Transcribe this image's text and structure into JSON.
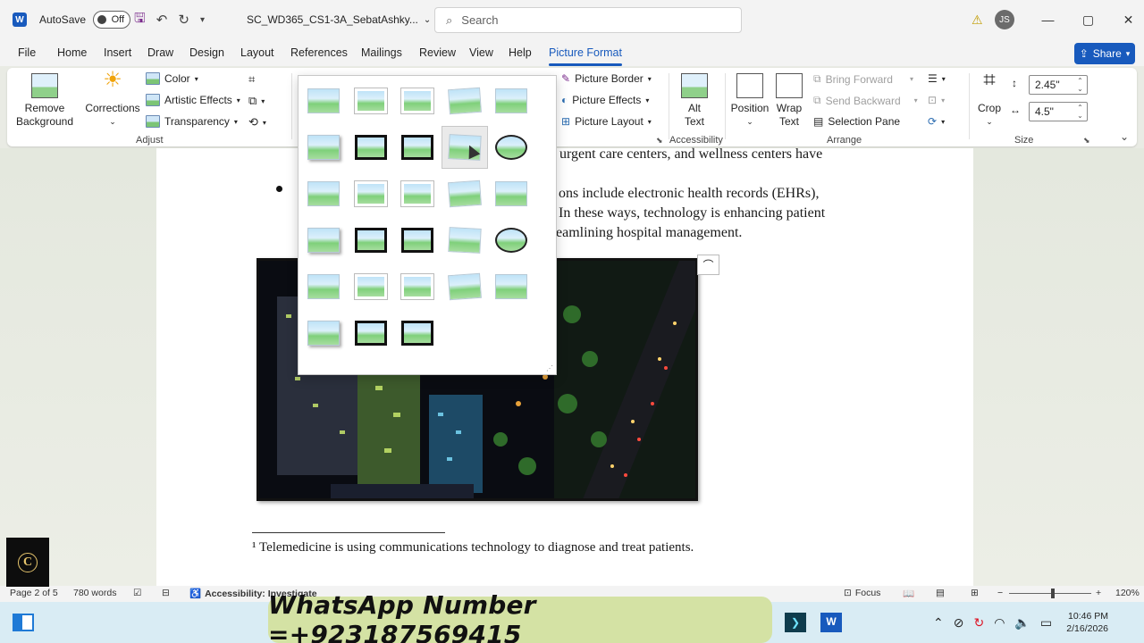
{
  "titlebar": {
    "app_icon": "word-icon",
    "autosave_label": "AutoSave",
    "autosave_state": "Off",
    "document_name": "SC_WD365_CS1-3A_SebatAshky...",
    "search_placeholder": "Search",
    "user_initials": "JS",
    "window_controls": [
      "—",
      "▢",
      "✕"
    ]
  },
  "menu": {
    "tabs": [
      "File",
      "Home",
      "Insert",
      "Draw",
      "Design",
      "Layout",
      "References",
      "Mailings",
      "Review",
      "View",
      "Help",
      "Picture Format"
    ],
    "active": "Picture Format",
    "share_label": "Share"
  },
  "ribbon": {
    "adjust": {
      "remove_background": [
        "Remove",
        "Background"
      ],
      "corrections": "Corrections",
      "color": "Color",
      "artistic_effects": "Artistic Effects",
      "transparency": "Transparency",
      "group_label": "Adjust"
    },
    "picture_styles": {
      "picture_border": "Picture Border",
      "picture_effects": "Picture Effects",
      "picture_layout": "Picture Layout"
    },
    "accessibility": {
      "alt_text": [
        "Alt",
        "Text"
      ],
      "group_label": "Accessibility"
    },
    "arrange": {
      "position": "Position",
      "wrap_text": [
        "Wrap",
        "Text"
      ],
      "bring_forward": "Bring Forward",
      "send_backward": "Send Backward",
      "selection_pane": "Selection Pane",
      "group_label": "Arrange"
    },
    "size": {
      "crop": "Crop",
      "height": "2.45\"",
      "width": "4.5\"",
      "group_label": "Size"
    }
  },
  "document": {
    "lines": [
      "urgent care centers, and wellness centers have",
      "ons include electronic health records (EHRs),",
      "In these ways, technology is enhancing patient",
      "eamlining hospital management."
    ],
    "footnote": "¹ Telemedicine is using communications technology to diagnose and treat patients."
  },
  "gallery": {
    "rows": 6,
    "cols": 5,
    "count": 28,
    "hovered_index": 8
  },
  "statusbar": {
    "page": "Page 2 of 5",
    "words": "780 words",
    "accessibility": "Accessibility: Investigate",
    "focus": "Focus",
    "zoom": "120%"
  },
  "taskbar": {
    "overlay_text": "WhatsApp Number =+923187569415",
    "time": "10:46 PM",
    "date": "2/16/2026"
  },
  "colors": {
    "accent": "#185abd",
    "titlebar_bg": "#f3f3f3",
    "taskbar_bg": "#d9ecf4"
  }
}
